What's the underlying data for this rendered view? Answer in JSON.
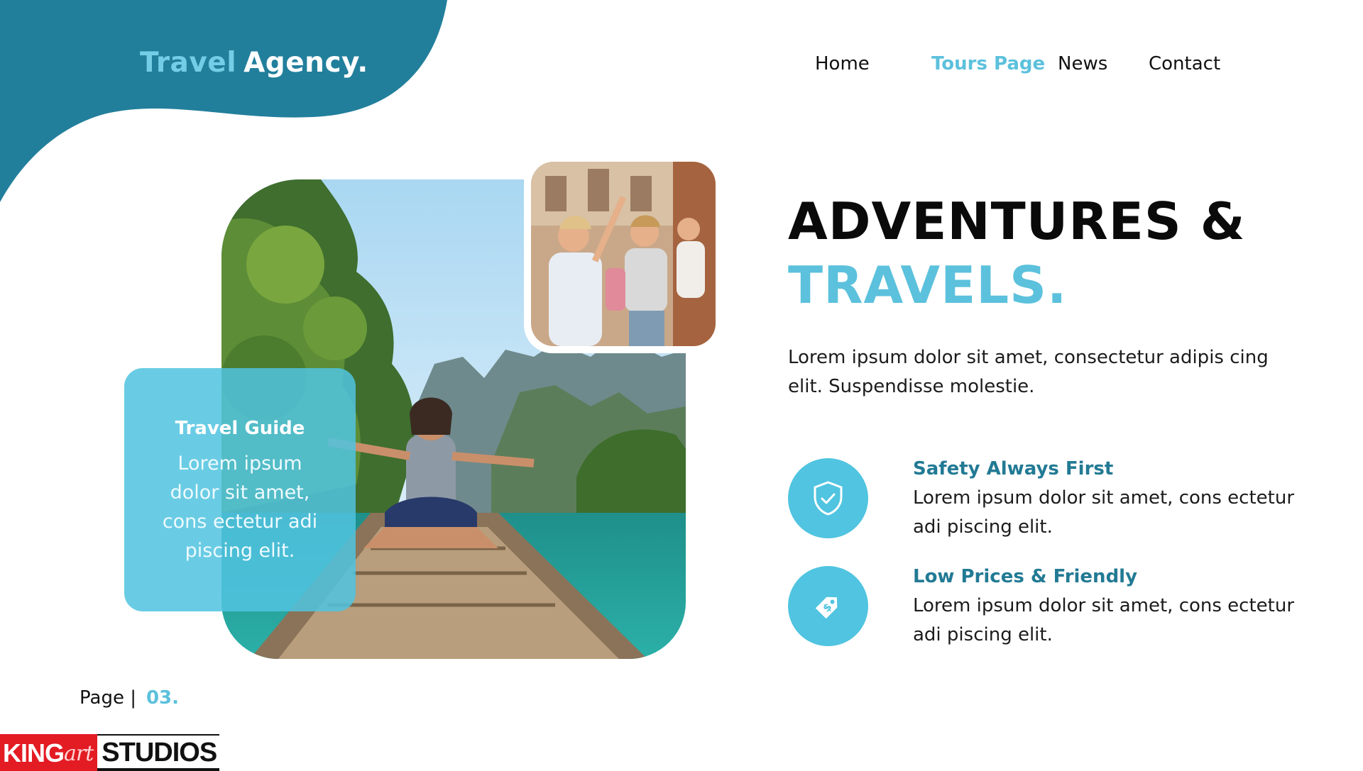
{
  "brand": {
    "part1": "Travel",
    "part2": "Agency."
  },
  "nav": {
    "items": [
      {
        "label": "Home",
        "active": false
      },
      {
        "label": "Tours Page",
        "active": true
      },
      {
        "label": "News",
        "active": false
      },
      {
        "label": "Contact",
        "active": false
      }
    ]
  },
  "guide_card": {
    "title": "Travel Guide",
    "body": "Lorem ipsum dolor sit amet, cons ectetur adi piscing elit."
  },
  "hero": {
    "headline_line1": "ADVENTURES &",
    "headline_line2": "TRAVELS.",
    "intro": "Lorem ipsum dolor sit amet, consectetur adipis cing elit. Suspendisse molestie."
  },
  "features": [
    {
      "icon": "shield-check-icon",
      "title": "Safety Always First",
      "text": "Lorem ipsum dolor sit amet, cons ectetur adi piscing elit."
    },
    {
      "icon": "price-tag-icon",
      "title": "Low Prices & Friendly",
      "text": "Lorem ipsum dolor sit amet, cons ectetur adi piscing elit."
    }
  ],
  "page": {
    "label": "Page |",
    "number": "03."
  },
  "watermark": {
    "part1": "KING",
    "part2": "art",
    "part3": "STUDIOS"
  },
  "colors": {
    "teal_dark": "#227f9c",
    "teal_light": "#5cc1dc",
    "text": "#111111"
  }
}
